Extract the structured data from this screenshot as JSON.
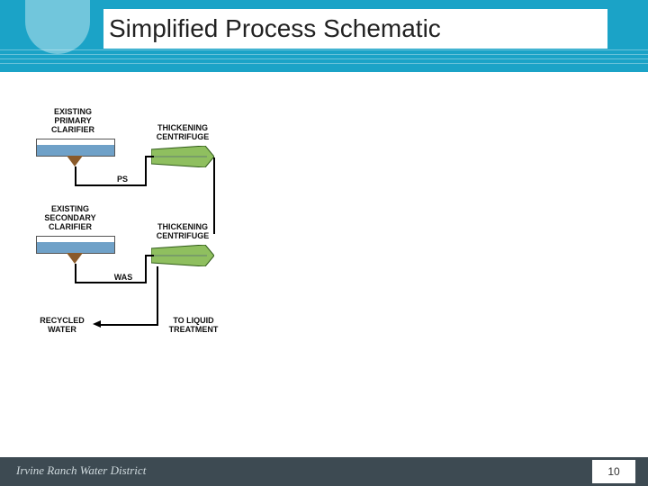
{
  "header": {
    "title": "Simplified Process Schematic"
  },
  "footer": {
    "org": "Irvine Ranch Water District",
    "page": "10"
  },
  "diagram": {
    "primary_label_1": "EXISTING",
    "primary_label_2": "PRIMARY",
    "primary_label_3": "CLARIFIER",
    "secondary_label_1": "EXISTING",
    "secondary_label_2": "SECONDARY",
    "secondary_label_3": "CLARIFIER",
    "centrifuge_label_1": "THICKENING",
    "centrifuge_label_2": "CENTRIFUGE",
    "ps_label": "PS",
    "was_label": "WAS",
    "recycled_1": "RECYCLED",
    "recycled_2": "WATER",
    "liquid_1": "TO LIQUID",
    "liquid_2": "TREATMENT"
  }
}
